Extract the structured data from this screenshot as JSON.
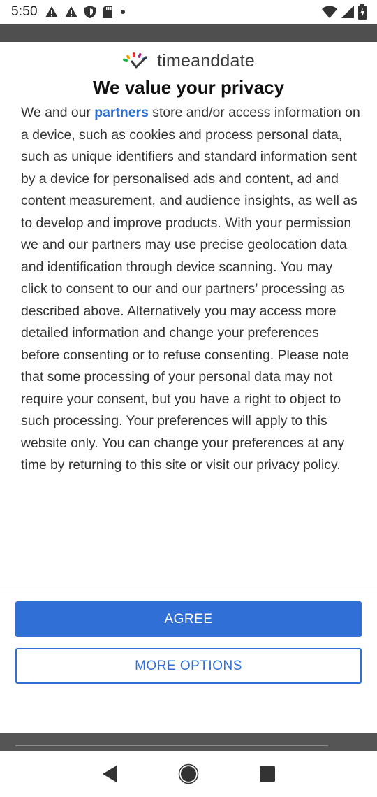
{
  "status_bar": {
    "time": "5:50",
    "left_icons": [
      "warning-icon",
      "warning-icon",
      "shield-icon",
      "sd-card-icon",
      "dot-icon"
    ],
    "right_icons": [
      "wifi-icon",
      "signal-icon",
      "battery-icon"
    ]
  },
  "consent": {
    "logo_text": "timeanddate",
    "title": "We value your privacy",
    "body_prefix": "We and our ",
    "partners_link": "partners",
    "body_rest": " store and/or access information on a device, such as cookies and process personal data, such as unique identifiers and standard information sent by a device for personalised ads and content, ad and content measurement, and audience insights, as well as to develop and improve products. With your permission we and our partners may use precise geolocation data and identification through device scanning. You may click to consent to our and our partners’ processing as described above. Alternatively you may access more detailed information and change your preferences before consenting or to refuse consenting. Please note that some processing of your personal data may not require your consent, but you have a right to object to such processing. Your preferences will apply to this website only. You can change your preferences at any time by returning to this site or visit our privacy policy.",
    "agree_label": "AGREE",
    "more_options_label": "MORE OPTIONS"
  },
  "colors": {
    "accent": "#2f6fd6",
    "link": "#2a6fd1",
    "underlay": "#4f4f4f"
  },
  "nav_bar": {
    "icons": [
      "back-icon",
      "home-icon",
      "recents-icon"
    ]
  }
}
